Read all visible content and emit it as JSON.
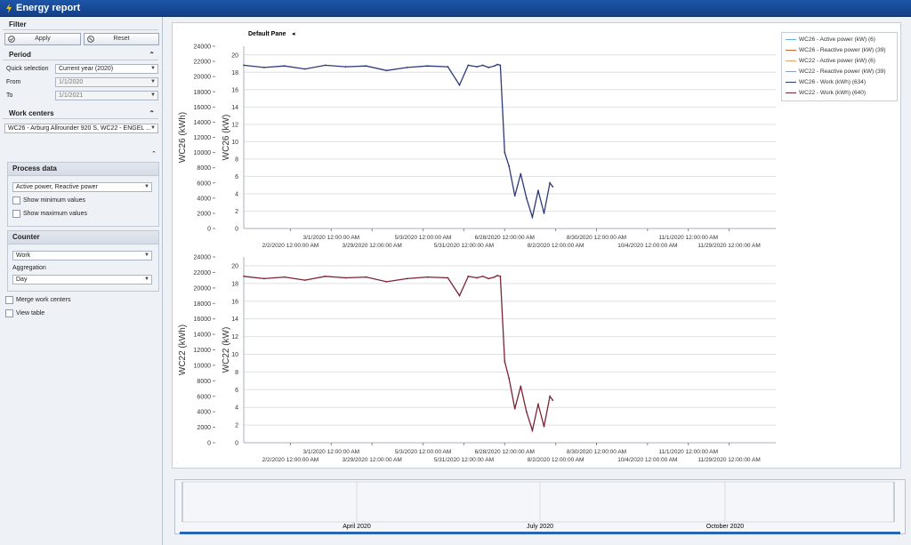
{
  "window": {
    "title": "Energy report"
  },
  "filter": {
    "title": "Filter",
    "apply_label": "Apply",
    "reset_label": "Reset"
  },
  "period": {
    "title": "Period",
    "quick_label": "Quick selection",
    "quick_value": "Current year (2020)",
    "from_label": "From",
    "from_value": "1/1/2020",
    "to_label": "To",
    "to_value": "1/1/2021"
  },
  "work_centers": {
    "title": "Work centers",
    "value": "WC26 - Arburg Allrounder 920 S, WC22 - ENGEL ..."
  },
  "process_data": {
    "title": "Process data",
    "value": "Active power, Reactive power",
    "show_min": "Show minimum values",
    "show_max": "Show maximum values"
  },
  "counter": {
    "title": "Counter",
    "value": "Work",
    "aggregation_label": "Aggregation",
    "aggregation_value": "Day"
  },
  "options": {
    "merge": "Merge work centers",
    "view_table": "View table"
  },
  "pane": {
    "title": "Default Pane",
    "arrow": "◂"
  },
  "legend": [
    {
      "label": "WC26 - Active power (kW) (6)",
      "color": "#5fb3dd"
    },
    {
      "label": "WC26 - Reactive power (kW) (39)",
      "color": "#d0622f"
    },
    {
      "label": "WC22 - Active power (kW) (6)",
      "color": "#e8a070"
    },
    {
      "label": "WC22 - Reactive power (kW) (39)",
      "color": "#8f9fc0"
    },
    {
      "label": "WC26 - Work (kWh) (634)",
      "color": "#2e3a78"
    },
    {
      "label": "WC22 - Work (kWh) (640)",
      "color": "#7a2433"
    }
  ],
  "chart_data": [
    {
      "type": "line",
      "title": "",
      "ylabel": "WC26 (kWh)",
      "ylabel2": "WC26 (kW)",
      "ylim": [
        0,
        24000
      ],
      "yticks": [
        "0",
        "2000",
        "4000",
        "6000",
        "8000",
        "10000",
        "12000",
        "14000",
        "16000",
        "18000",
        "20000",
        "22000",
        "24000"
      ],
      "ylim2": [
        0,
        21
      ],
      "yticks2": [
        "0",
        "2",
        "4",
        "6",
        "8",
        "10",
        "12",
        "14",
        "16",
        "18",
        "20"
      ],
      "xlim": [
        "1/1/2020",
        "12/31/2020"
      ],
      "xticks_upper": [
        "3/1/2020 12:00:00 AM",
        "5/3/2020 12:00:00 AM",
        "6/28/2020 12:00:00 AM",
        "8/30/2020 12:00:00 AM",
        "11/1/2020 12:00:00 AM"
      ],
      "xticks_lower": [
        "2/2/2020 12:00:00 AM",
        "3/29/2020 12:00:00 AM",
        "5/31/2020 12:00:00 AM",
        "8/2/2020 12:00:00 AM",
        "10/4/2020 12:00:00 AM",
        "11/29/2020 12:00:00 AM"
      ],
      "grid": true,
      "series": [
        {
          "name": "WC26 - Work (kWh) (634)",
          "color": "#2e3a78",
          "x": [
            "1/1/2020",
            "1/15/2020",
            "1/29/2020",
            "2/12/2020",
            "2/26/2020",
            "3/11/2020",
            "3/25/2020",
            "4/8/2020",
            "4/22/2020",
            "5/6/2020",
            "5/20/2020",
            "5/28/2020",
            "6/3/2020",
            "6/9/2020",
            "6/13/2020",
            "6/17/2020",
            "6/21/2020",
            "6/23/2020",
            "6/25/2020",
            "6/28/2020",
            "7/1/2020",
            "7/5/2020",
            "7/9/2020",
            "7/13/2020",
            "7/17/2020",
            "7/21/2020",
            "7/25/2020",
            "7/29/2020",
            "7/31/2020"
          ],
          "values": [
            21500,
            21200,
            21400,
            21000,
            21500,
            21300,
            21400,
            20800,
            21200,
            21400,
            21300,
            18900,
            21500,
            21300,
            21500,
            21200,
            21400,
            21600,
            21500,
            10000,
            8200,
            4300,
            7200,
            4000,
            1500,
            5000,
            2000,
            6000,
            5500
          ]
        }
      ]
    },
    {
      "type": "line",
      "title": "",
      "ylabel": "WC22 (kWh)",
      "ylabel2": "WC22 (kW)",
      "ylim": [
        0,
        24000
      ],
      "yticks": [
        "0",
        "2000",
        "4000",
        "6000",
        "8000",
        "10000",
        "12000",
        "14000",
        "16000",
        "18000",
        "20000",
        "22000",
        "24000"
      ],
      "ylim2": [
        0,
        21
      ],
      "yticks2": [
        "0",
        "2",
        "4",
        "6",
        "8",
        "10",
        "12",
        "14",
        "16",
        "18",
        "20"
      ],
      "xlim": [
        "1/1/2020",
        "12/31/2020"
      ],
      "xticks_upper": [
        "3/1/2020 12:00:00 AM",
        "5/3/2020 12:00:00 AM",
        "6/28/2020 12:00:00 AM",
        "8/30/2020 12:00:00 AM",
        "11/1/2020 12:00:00 AM"
      ],
      "xticks_lower": [
        "2/2/2020 12:00:00 AM",
        "3/29/2020 12:00:00 AM",
        "5/31/2020 12:00:00 AM",
        "8/2/2020 12:00:00 AM",
        "10/4/2020 12:00:00 AM",
        "11/29/2020 12:00:00 AM"
      ],
      "grid": true,
      "series": [
        {
          "name": "WC22 - Work (kWh) (640)",
          "color": "#7a2433",
          "x": [
            "1/1/2020",
            "1/15/2020",
            "1/29/2020",
            "2/12/2020",
            "2/26/2020",
            "3/11/2020",
            "3/25/2020",
            "4/8/2020",
            "4/22/2020",
            "5/6/2020",
            "5/20/2020",
            "5/28/2020",
            "6/3/2020",
            "6/9/2020",
            "6/13/2020",
            "6/17/2020",
            "6/21/2020",
            "6/23/2020",
            "6/25/2020",
            "6/28/2020",
            "7/1/2020",
            "7/5/2020",
            "7/9/2020",
            "7/13/2020",
            "7/17/2020",
            "7/21/2020",
            "7/25/2020",
            "7/29/2020",
            "7/31/2020"
          ],
          "values": [
            21500,
            21200,
            21400,
            21000,
            21500,
            21300,
            21400,
            20800,
            21200,
            21400,
            21300,
            19000,
            21500,
            21300,
            21500,
            21200,
            21400,
            21600,
            21500,
            10500,
            8300,
            4400,
            7300,
            4000,
            1600,
            5000,
            2100,
            6000,
            5500
          ]
        }
      ]
    }
  ],
  "navigator": {
    "labels": [
      "April 2020",
      "July 2020",
      "October 2020"
    ]
  }
}
